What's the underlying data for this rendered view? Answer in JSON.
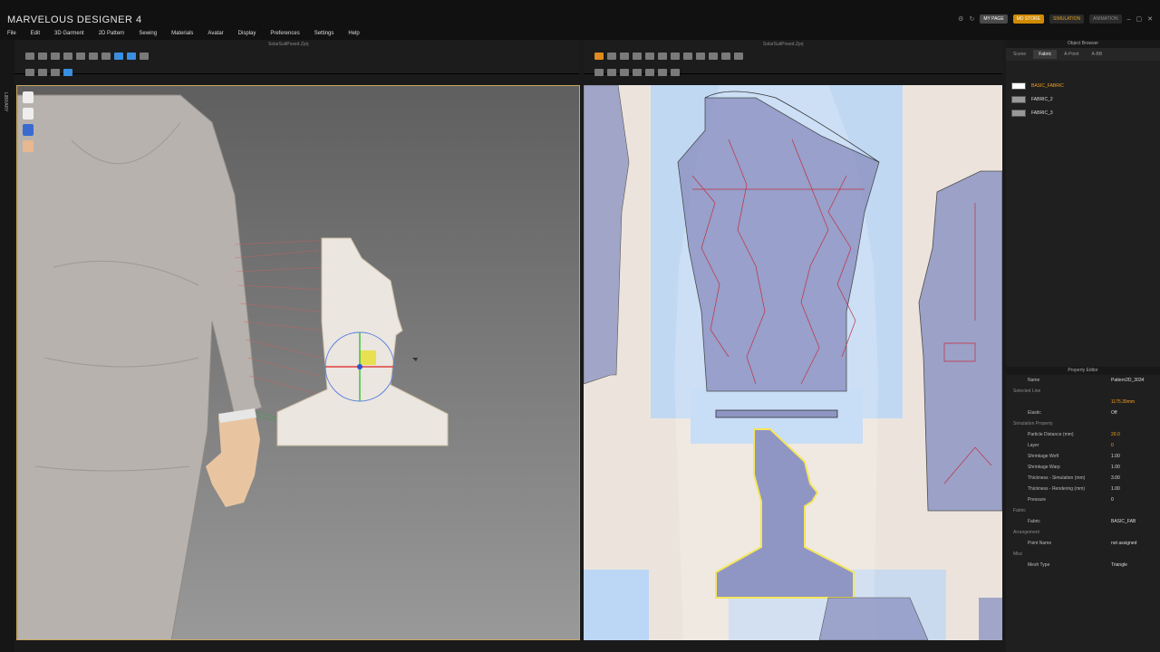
{
  "app": {
    "title": "MARVELOUS DESIGNER 4"
  },
  "top_right": {
    "my_page": "MY PAGE",
    "md_store": "MD STORE",
    "simulation": "SIMULATION",
    "animation": "ANIMATION"
  },
  "menu": [
    "File",
    "Edit",
    "3D Garment",
    "2D Pattern",
    "Sewing",
    "Materials",
    "Avatar",
    "Display",
    "Preferences",
    "Settings",
    "Help"
  ],
  "left_window": {
    "label": "SolarSuitPosed.Zprj"
  },
  "right_window": {
    "label": "SolarSuitPosed.Zprj"
  },
  "library": {
    "label": "LIBRARY"
  },
  "object_browser": {
    "title": "Object Browser",
    "tabs": [
      "Scene",
      "Fabric",
      "A-Point",
      "A-BB"
    ],
    "active_tab": "Fabric",
    "fabrics": [
      "BASIC_FABRIC",
      "FABRIC_2",
      "FABRIC_3"
    ]
  },
  "property_editor": {
    "title": "Property Editor",
    "name_label": "Name",
    "name_value": "Pattern2D_3034",
    "selected_line": "Selected Line",
    "length_value": "1175.39mm",
    "elastic_label": "Elastic",
    "elastic_value": "Off",
    "simulation_property": "Simulation Property",
    "particle_distance_label": "Particle Distance (mm)",
    "particle_distance_value": "20.0",
    "layer_label": "Layer",
    "layer_value": "0",
    "shrinkage_weft_label": "Shrinkage Weft",
    "shrinkage_weft_value": "1.00",
    "shrinkage_warp_label": "Shrinkage Warp",
    "shrinkage_warp_value": "1.00",
    "thickness_sim_label": "Thickness - Simulation (mm)",
    "thickness_sim_value": "3.00",
    "thickness_render_label": "Thickness - Rendering (mm)",
    "thickness_render_value": "1.00",
    "pressure_label": "Pressure",
    "pressure_value": "0",
    "fabric_section": "Fabric",
    "fabric_label": "Fabric",
    "fabric_value": "BASIC_FAB",
    "arrangement_section": "Arrangement",
    "point_name_label": "Point Name",
    "point_name_value": "not assigned",
    "misc_section": "Misc",
    "mesh_type_label": "Mesh Type",
    "mesh_type_value": "Triangle"
  },
  "colors": {
    "accent": "#f0a020",
    "selection": "#f5e65a",
    "pattern": "#8f96c4",
    "seam": "#c03040"
  }
}
